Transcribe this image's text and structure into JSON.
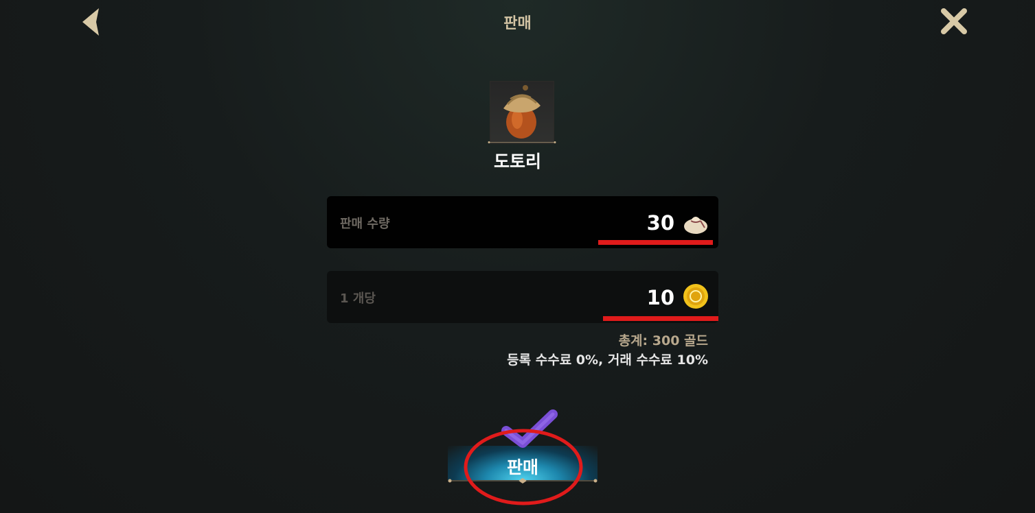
{
  "header": {
    "title": "판매",
    "back_icon": "chevron-left-icon",
    "close_icon": "close-icon"
  },
  "item": {
    "name": "도토리",
    "icon": "acorn-icon"
  },
  "quantity_field": {
    "label": "판매 수량",
    "value": "30",
    "icon": "pouch-icon"
  },
  "price_field": {
    "label": "1 개당",
    "value": "10",
    "icon": "gold-coin-icon"
  },
  "summary": {
    "total": "총계: 300 골드",
    "fees": "등록 수수료 0%, 거래 수수료 10%"
  },
  "sell_button": {
    "label": "판매"
  },
  "colors": {
    "accent_gold": "#d3c4a4",
    "annotation_red": "#e01b1b",
    "annotation_check": "#7a4fd6",
    "button_glow": "#4fd3ef"
  }
}
